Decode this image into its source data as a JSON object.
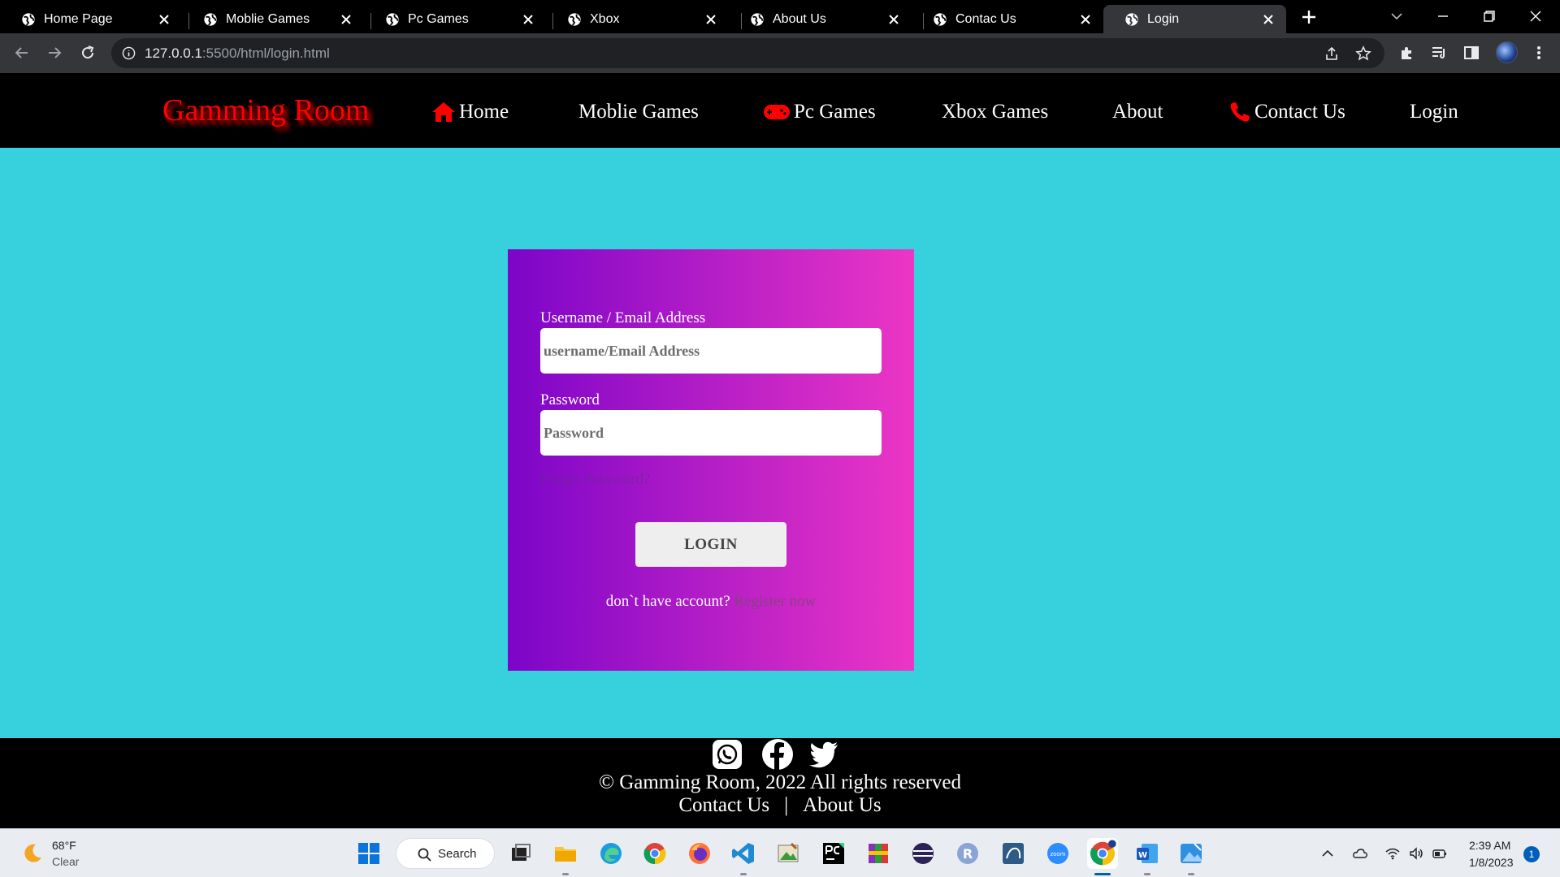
{
  "browser": {
    "tabs": [
      {
        "title": "Home Page"
      },
      {
        "title": "Moblie Games"
      },
      {
        "title": "Pc Games"
      },
      {
        "title": "Xbox"
      },
      {
        "title": "About Us"
      },
      {
        "title": "Contac Us"
      },
      {
        "title": "Login"
      }
    ],
    "active_tab": "Login",
    "url_host": "127.0.0.1",
    "url_path": ":5500/html/login.html"
  },
  "site": {
    "logo": "Gamming Room",
    "nav": [
      {
        "label": "Home",
        "icon": "home-icon"
      },
      {
        "label": "Moblie Games",
        "icon": ""
      },
      {
        "label": "Pc Games",
        "icon": "gamepad-icon"
      },
      {
        "label": "Xbox Games",
        "icon": ""
      },
      {
        "label": "About",
        "icon": ""
      },
      {
        "label": "Contact Us",
        "icon": "phone-icon"
      },
      {
        "label": "Login",
        "icon": ""
      }
    ],
    "colors": {
      "logo": "#ff0000",
      "main_background": "#37d1dd",
      "card_gradient_start": "#7c05c8",
      "card_gradient_end": "#ec36c5"
    }
  },
  "login": {
    "username_label": "Username / Email Address",
    "username_placeholder": "username/Email Address",
    "password_label": "Password",
    "password_placeholder": "Password",
    "forget_password": "Forget Password?",
    "login_button": "LOGIN",
    "no_account_text": "don`t have account?",
    "register_link": "Register now"
  },
  "footer": {
    "social_icons": [
      "whatsapp-icon",
      "facebook-icon",
      "twitter-icon"
    ],
    "copyright": "© Gamming Room, 2022 All rights reserved",
    "links": [
      "Contact Us",
      "About Us"
    ],
    "separator": "|"
  },
  "taskbar": {
    "weather_temp": "68°F",
    "weather_condition": "Clear",
    "search_label": "Search",
    "time": "2:39 AM",
    "date": "1/8/2023",
    "notification_count": "1"
  }
}
